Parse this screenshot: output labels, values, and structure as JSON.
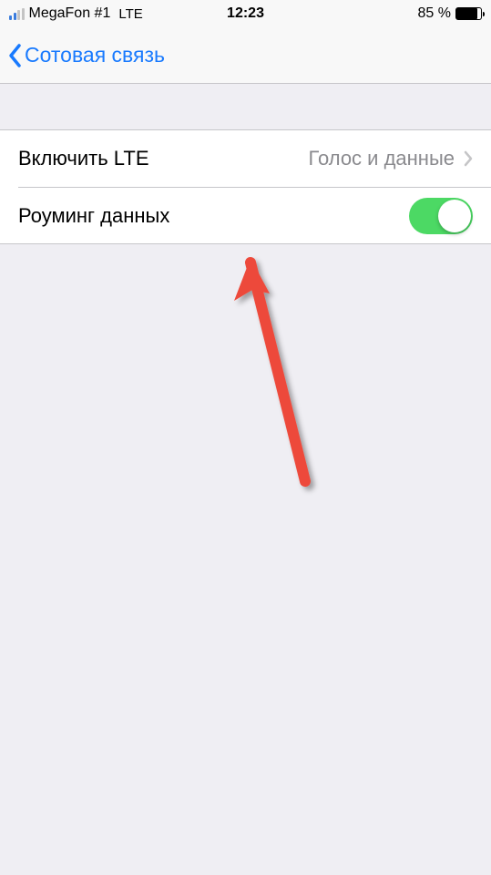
{
  "statusBar": {
    "carrier": "MegaFon #1",
    "networkType": "LTE",
    "time": "12:23",
    "batteryText": "85 %"
  },
  "nav": {
    "backLabel": "Сотовая связь"
  },
  "settings": {
    "row1": {
      "label": "Включить LTE",
      "value": "Голос и данные"
    },
    "row2": {
      "label": "Роуминг данных"
    }
  }
}
